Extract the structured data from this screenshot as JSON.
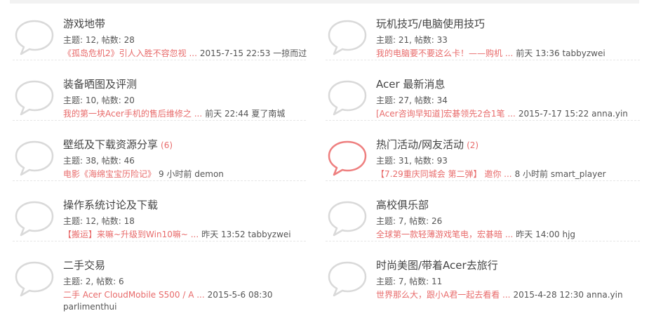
{
  "forums": {
    "left": [
      {
        "title": "游戏地带",
        "new_count": "",
        "stats": "主题: 12, 帖数: 28",
        "last_post": "《孤岛危机2》引人入胜不容忽视 ...",
        "last_meta": "2015-7-15 22:53 一掠而过",
        "last_meta2": "",
        "highlight": false
      },
      {
        "title": "装备晒图及评测",
        "new_count": "",
        "stats": "主题: 10, 帖数: 20",
        "last_post": "我的第一块Acer手机的售后维修之 ...",
        "last_meta": "前天 22:44 夏了南城",
        "last_meta2": "",
        "highlight": false
      },
      {
        "title": "壁纸及下载资源分享",
        "new_count": "(6)",
        "stats": "主题: 38, 帖数: 46",
        "last_post": "电影《海绵宝宝历险记》",
        "last_meta": "9 小时前 demon",
        "last_meta2": "",
        "highlight": false
      },
      {
        "title": "操作系统讨论及下载",
        "new_count": "",
        "stats": "主题: 12, 帖数: 18",
        "last_post": "【搬运】来嘛~升级到Win10嘛~ ...",
        "last_meta": "昨天 13:52 tabbyzwei",
        "last_meta2": "",
        "highlight": false
      },
      {
        "title": "二手交易",
        "new_count": "",
        "stats": "主题: 2, 帖数: 6",
        "last_post": "二手 Acer CloudMobile S500 / A ...",
        "last_meta": "2015-5-6 08:30",
        "last_meta2": "parlimenthui",
        "highlight": false
      }
    ],
    "right": [
      {
        "title": "玩机技巧/电脑使用技巧",
        "new_count": "",
        "stats": "主题: 21, 帖数: 33",
        "last_post": "我的电脑要不要这么卡！——购机 ...",
        "last_meta": "前天 13:36 tabbyzwei",
        "last_meta2": "",
        "highlight": false
      },
      {
        "title": "Acer 最新消息",
        "new_count": "",
        "stats": "主题: 27, 帖数: 34",
        "last_post": "[Acer咨询早知道]宏碁领先2合1笔 ...",
        "last_meta": "2015-7-17 15:22 anna.yin",
        "last_meta2": "",
        "highlight": false
      },
      {
        "title": "热门活动/网友活动",
        "new_count": "(2)",
        "stats": "主题: 31, 帖数: 93",
        "last_post": "【7.29重庆同城会 第二弹】 邀你 ...",
        "last_meta": "8 小时前 smart_player",
        "last_meta2": "",
        "highlight": true
      },
      {
        "title": "高校俱乐部",
        "new_count": "",
        "stats": "主题: 7, 帖数: 26",
        "last_post": "全球第一款轻薄游戏笔电，宏碁暗 ...",
        "last_meta": "昨天 14:00 hjg",
        "last_meta2": "",
        "highlight": false
      },
      {
        "title": "时尚美图/带着Acer去旅行",
        "new_count": "",
        "stats": "主题: 7, 帖数: 11",
        "last_post": "世界那么大，跟小A君一起去看看 ...",
        "last_meta": "2015-4-28 12:30 anna.yin",
        "last_meta2": "",
        "highlight": false
      }
    ]
  },
  "colors": {
    "accent": "#e86b6b",
    "bubble_normal": "#d9d9d9",
    "bubble_highlight": "#ee7f7f"
  }
}
